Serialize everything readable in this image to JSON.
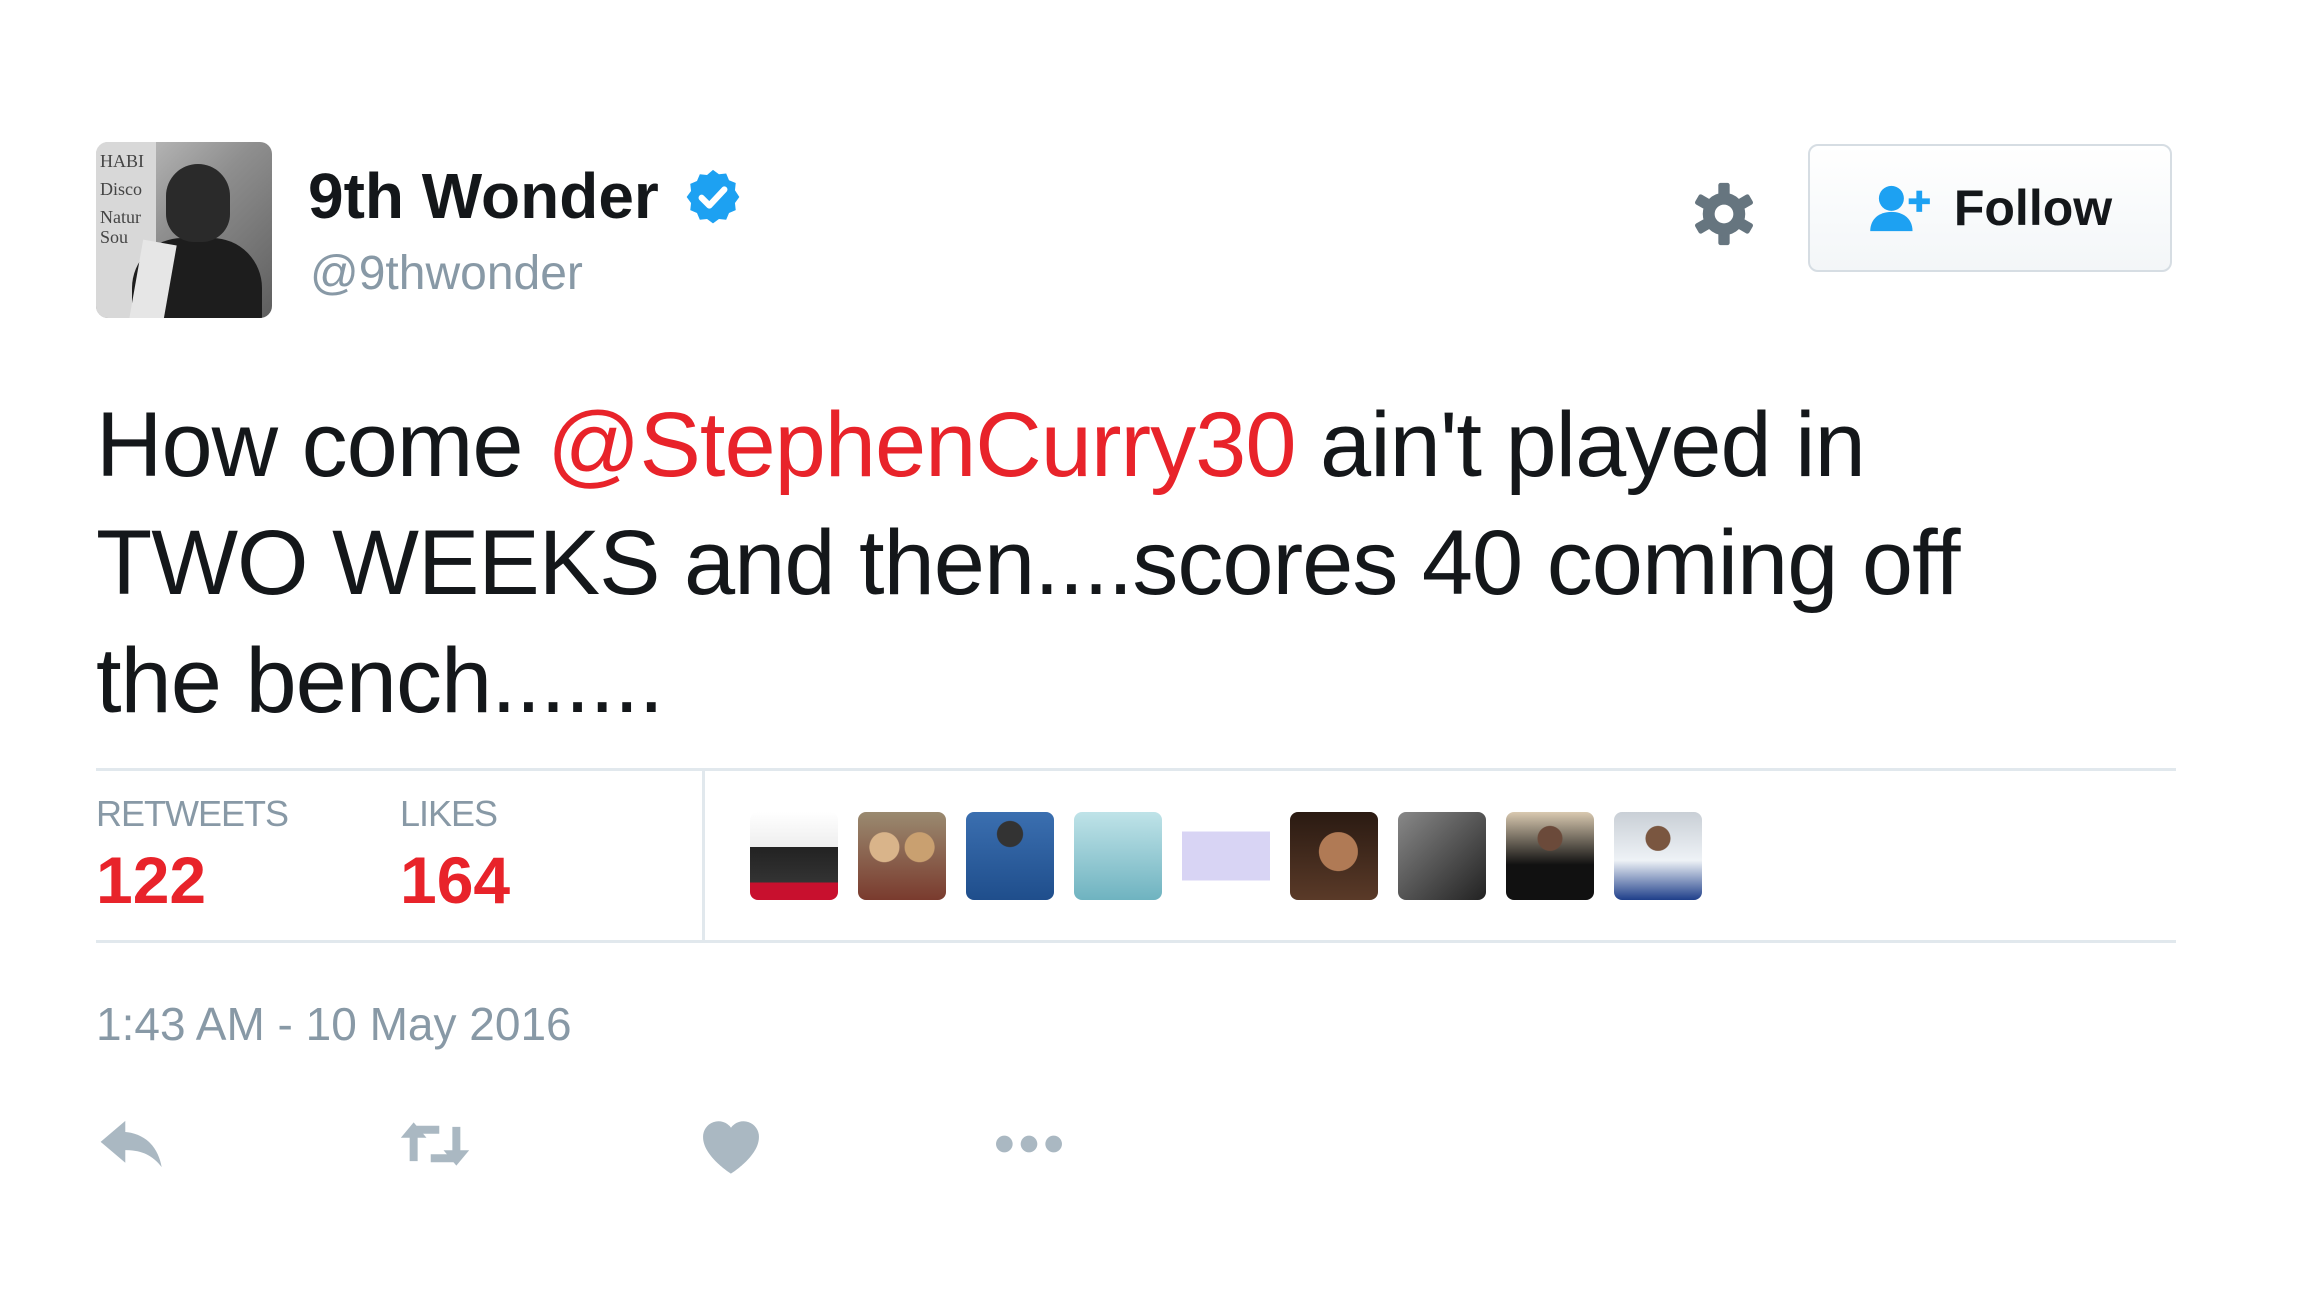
{
  "author": {
    "display_name": "9th Wonder",
    "handle": "@9thwonder",
    "verified_icon": "verified-badge-icon",
    "avatar_poster_lettering": [
      "HABI",
      "Disco",
      "Natur",
      "Sou"
    ]
  },
  "header": {
    "settings_icon": "gear-icon",
    "follow_button": {
      "label": "Follow",
      "icon": "add-user-icon"
    }
  },
  "tweet": {
    "line1_before": "How come ",
    "mention": "@StephenCurry30",
    "line1_after": " ain't played in",
    "line2": "TWO WEEKS and then....scores 40 coming off",
    "line3": "the bench......."
  },
  "stats": {
    "retweets_label": "RETWEETS",
    "retweets_count": "122",
    "likes_label": "LIKES",
    "likes_count": "164"
  },
  "likers_count_shown": 9,
  "timestamp": "1:43 AM - 10 May 2016",
  "actions": [
    "reply-icon",
    "retweet-icon",
    "like-heart-icon",
    "more-icon"
  ],
  "colors": {
    "mention": "#e8232a",
    "stat_number": "#e8232a",
    "verified": "#1da1f2",
    "muted": "#8899a6",
    "follow_icon": "#1da1f2",
    "text": "#14171a"
  }
}
